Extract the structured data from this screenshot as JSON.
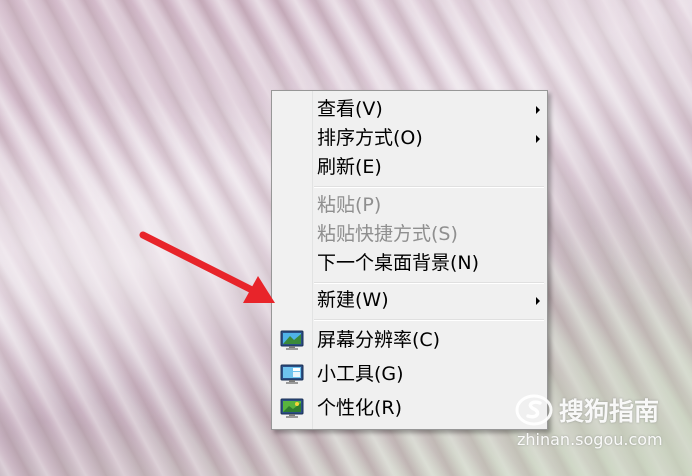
{
  "context_menu": {
    "items": [
      {
        "label": "查看(V)",
        "enabled": true,
        "submenu": true
      },
      {
        "label": "排序方式(O)",
        "enabled": true,
        "submenu": true
      },
      {
        "label": "刷新(E)",
        "enabled": true,
        "submenu": false
      },
      {
        "label": "粘贴(P)",
        "enabled": false,
        "submenu": false
      },
      {
        "label": "粘贴快捷方式(S)",
        "enabled": false,
        "submenu": false
      },
      {
        "label": "下一个桌面背景(N)",
        "enabled": true,
        "submenu": false
      },
      {
        "label": "新建(W)",
        "enabled": true,
        "submenu": true
      },
      {
        "label": "屏幕分辨率(C)",
        "enabled": true,
        "submenu": false,
        "icon": "monitor-resolution-icon"
      },
      {
        "label": "小工具(G)",
        "enabled": true,
        "submenu": false,
        "icon": "gadgets-icon"
      },
      {
        "label": "个性化(R)",
        "enabled": true,
        "submenu": false,
        "icon": "personalize-icon"
      }
    ]
  },
  "annotation": {
    "arrow_color": "#e8242a",
    "points_to": "新建(W)"
  },
  "watermark": {
    "brand": "搜狗指南",
    "url": "zhinan.sogou.com"
  },
  "colors": {
    "menu_background": "#f0f0f0",
    "menu_border": "#979797",
    "disabled_text": "#8f8f8f"
  }
}
